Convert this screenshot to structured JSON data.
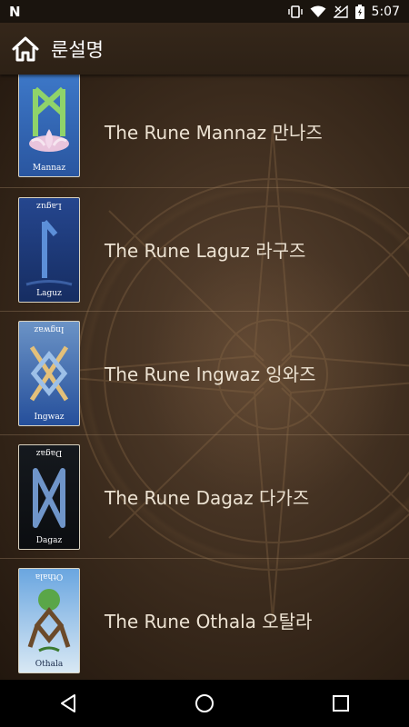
{
  "status_bar": {
    "left_icon": "N",
    "time": "5:07",
    "icons": [
      "vibrate-icon",
      "wifi-icon",
      "no-signal-icon",
      "battery-icon"
    ]
  },
  "app_bar": {
    "title": "룬설명",
    "home_icon": "home-icon"
  },
  "runes": [
    {
      "label": "The Rune Mannaz 만나즈",
      "card_caption": "Mannaz",
      "card_color": "#2d5aa8"
    },
    {
      "label": "The Rune Laguz 라구즈",
      "card_caption": "Laguz",
      "card_color": "#1e3f86"
    },
    {
      "label": "The Rune Ingwaz 잉와즈",
      "card_caption": "Ingwaz",
      "card_color": "#1f4fa6"
    },
    {
      "label": "The Rune Dagaz 다가즈",
      "card_caption": "Dagaz",
      "card_color": "#101418"
    },
    {
      "label": "The Rune Othala 오탈라",
      "card_caption": "Othala",
      "card_color": "#3a78c4"
    }
  ],
  "nav_bar": {
    "back_icon": "back-triangle-icon",
    "home_icon": "home-circle-icon",
    "recents_icon": "recents-square-icon"
  }
}
